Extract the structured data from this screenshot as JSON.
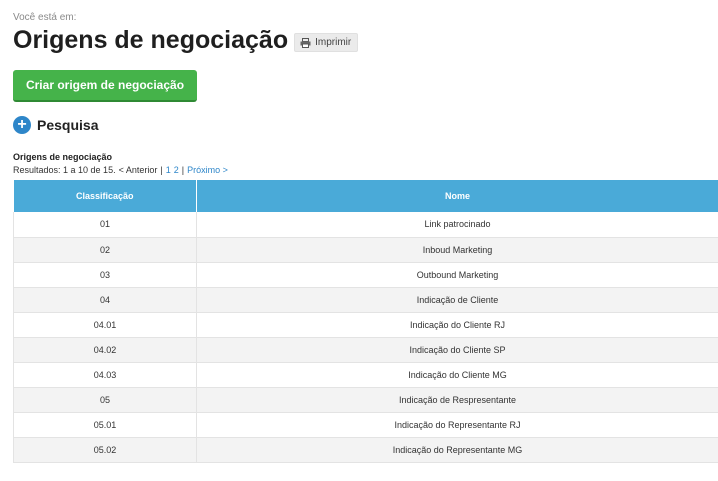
{
  "breadcrumb": "Você está em:",
  "page_title": "Origens de negociação",
  "print_label": "Imprimir",
  "create_button": "Criar origem de negociação",
  "search_label": "Pesquisa",
  "search_icon": "+",
  "section_title": "Origens de negociação",
  "pagination": {
    "results_text": "Resultados: 1 a 10 de 15.",
    "prev": "< Anterior",
    "separator": "|",
    "current_page": "1",
    "page_2": "2",
    "separator2": "|",
    "next": "Próximo >"
  },
  "table": {
    "headers": [
      "Classificação",
      "Nome"
    ],
    "rows": [
      {
        "code": "01",
        "name": "Link patrocinado"
      },
      {
        "code": "02",
        "name": "Inboud Marketing"
      },
      {
        "code": "03",
        "name": "Outbound Marketing"
      },
      {
        "code": "04",
        "name": "Indicação de Cliente"
      },
      {
        "code": "04.01",
        "name": "Indicação do Cliente RJ"
      },
      {
        "code": "04.02",
        "name": "Indicação do Cliente SP"
      },
      {
        "code": "04.03",
        "name": "Indicação do Cliente MG"
      },
      {
        "code": "05",
        "name": "Indicação de Respresentante"
      },
      {
        "code": "05.01",
        "name": "Indicação do Representante RJ"
      },
      {
        "code": "05.02",
        "name": "Indicação do Representante MG"
      }
    ]
  },
  "colors": {
    "create_button": "#45b34a",
    "table_header": "#4aaad8",
    "link": "#2e86c9",
    "plus_icon": "#2e86c9"
  }
}
